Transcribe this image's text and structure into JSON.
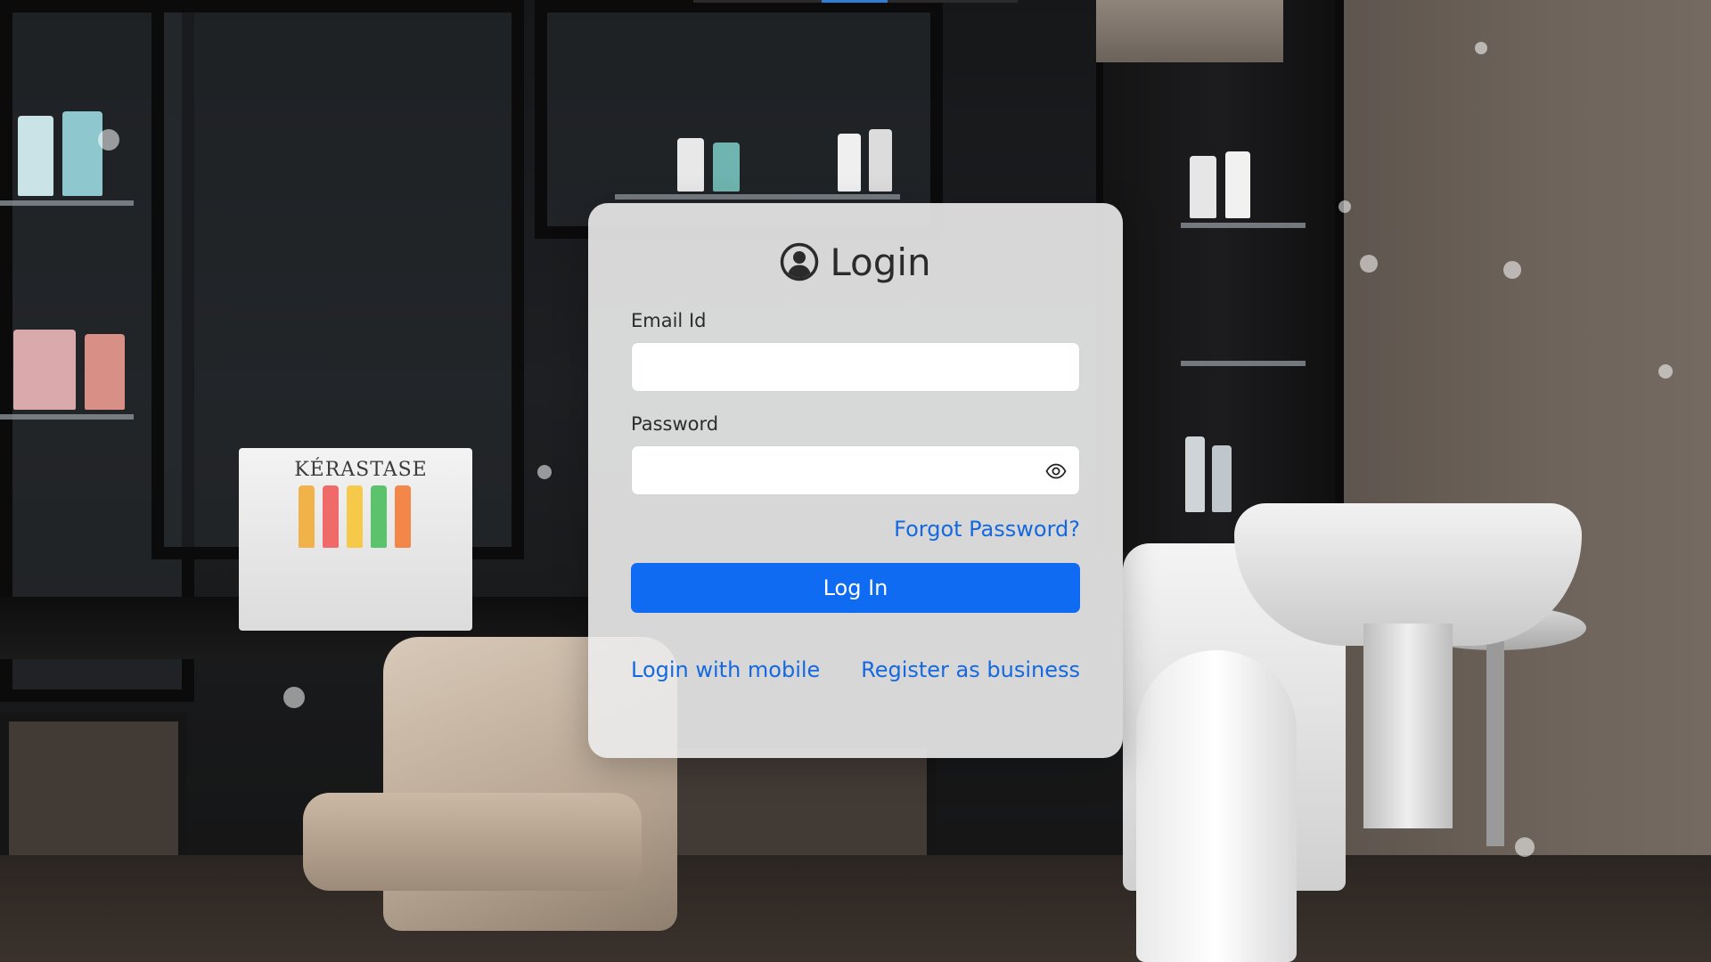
{
  "login": {
    "title": "Login",
    "title_icon": "user-circle-icon",
    "email": {
      "label": "Email Id",
      "value": "",
      "placeholder": ""
    },
    "password": {
      "label": "Password",
      "value": "",
      "placeholder": "",
      "toggle_icon": "eye-icon"
    },
    "forgot_password": "Forgot Password?",
    "submit_label": "Log In",
    "login_with_mobile": "Login with mobile",
    "register_business": "Register as business"
  },
  "background": {
    "display_brand": "KÉRASTASE"
  },
  "colors": {
    "accent": "#0f6cf2",
    "link": "#1469e0",
    "card_bg": "#ececec",
    "text": "#2b2b2b"
  }
}
